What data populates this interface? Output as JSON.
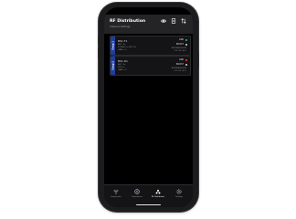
{
  "header": {
    "title": "RF Distribution",
    "subtitle": "Antenna Settings"
  },
  "cards": [
    {
      "tab": "Group 1",
      "name": "BS1-T1",
      "lines": [
        "ANT  -3+",
        "POWER  On      5W  10+",
        "GAIN  +  5"
      ],
      "status": "LINK",
      "status_color": "#34c759",
      "mode": "BOOST",
      "detail_1": "ANTENNA ASSIGN",
      "detail_2": "Ch2  Ch3  Ch4  1"
    },
    {
      "tab": "Group 2",
      "name": "BS1-R1",
      "lines": [
        "ANT  -3+",
        "MIX  On",
        "GAIN  +  5"
      ],
      "status": "LINK",
      "status_color": "#ff3b30",
      "mode": "BOOST",
      "detail_1": "ANTENNA ASSIGN",
      "detail_2": "Ch1  Ch2  Ch3  1"
    }
  ],
  "tabbar": {
    "items": [
      {
        "label": "Frequencies",
        "icon": "antenna-icon"
      },
      {
        "label": "Transmitters",
        "icon": "transmitter-icon"
      },
      {
        "label": "RF Distribution",
        "icon": "rf-distribution-icon"
      },
      {
        "label": "Settings",
        "icon": "settings-icon"
      }
    ],
    "active_index": 2
  },
  "colors": {
    "group_tab": "#1f3d9c",
    "link_ok": "#34c759",
    "link_alert": "#ff3b30"
  }
}
